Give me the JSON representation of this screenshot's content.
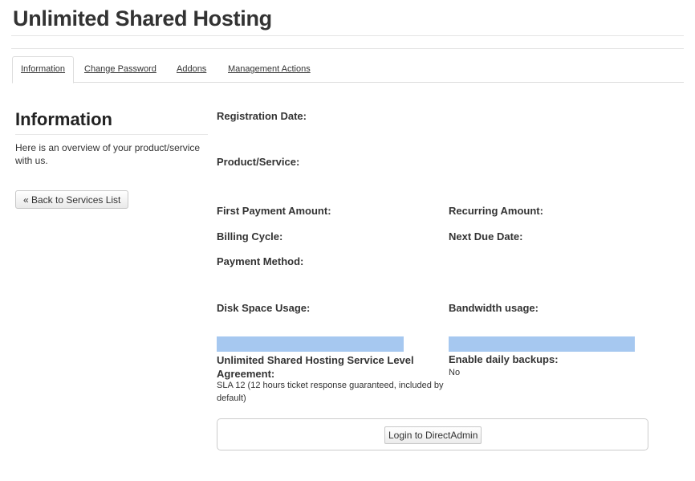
{
  "header": {
    "title": "Unlimited Shared Hosting"
  },
  "tabs": [
    {
      "label": "Information"
    },
    {
      "label": "Change Password"
    },
    {
      "label": "Addons"
    },
    {
      "label": "Management Actions"
    }
  ],
  "sidebar": {
    "title": "Information",
    "description": "Here is an overview of your product/service with us.",
    "back_button": "« Back to Services List"
  },
  "details": {
    "registration_date_label": "Registration Date:",
    "product_service_label": "Product/Service:",
    "first_payment_label": "First Payment Amount:",
    "recurring_amount_label": "Recurring Amount:",
    "billing_cycle_label": "Billing Cycle:",
    "next_due_date_label": "Next Due Date:",
    "payment_method_label": "Payment Method:",
    "disk_usage_label": "Disk Space Usage:",
    "bandwidth_usage_label": "Bandwidth usage:",
    "sla_label": "Unlimited Shared Hosting Service Level Agreement:",
    "sla_value": "SLA 12 (12 hours ticket response guaranteed, included by default)",
    "daily_backups_label": "Enable daily backups:",
    "daily_backups_value": "No",
    "login_button": "Login to DirectAdmin"
  },
  "colors": {
    "usage_bar": "#a6c8f0"
  }
}
